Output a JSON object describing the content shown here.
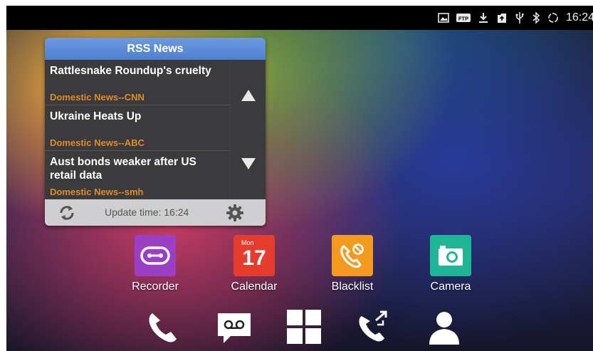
{
  "status_bar": {
    "icons": [
      "picture-icon",
      "ftp-icon",
      "download-icon",
      "share-icon",
      "usb-icon",
      "bluetooth-icon",
      "sync-icon"
    ],
    "ftp_label": "FTP",
    "time": "16:24"
  },
  "rss_widget": {
    "title": "RSS News",
    "items": [
      {
        "headline": "Rattlesnake Roundup's cruelty",
        "source": "Domestic News--CNN"
      },
      {
        "headline": "Ukraine Heats Up",
        "source": "Domestic News--ABC"
      },
      {
        "headline": "Aust bonds weaker after US retail data",
        "source": "Domestic News--smh"
      }
    ],
    "update_time": "Update time: 16:24",
    "colors": {
      "header": "#5b8bd8",
      "source_text": "#e08a2a"
    }
  },
  "apps": [
    {
      "label": "Recorder",
      "color": "#9b3fc4"
    },
    {
      "label": "Calendar",
      "color": "#e53c2e",
      "month": "Mon",
      "day": "17"
    },
    {
      "label": "Blacklist",
      "color": "#f39a1f"
    },
    {
      "label": "Camera",
      "color": "#1fb597"
    }
  ],
  "dock": [
    "phone-icon",
    "voicemail-icon",
    "apps-grid-icon",
    "call-forward-icon",
    "contacts-icon"
  ]
}
